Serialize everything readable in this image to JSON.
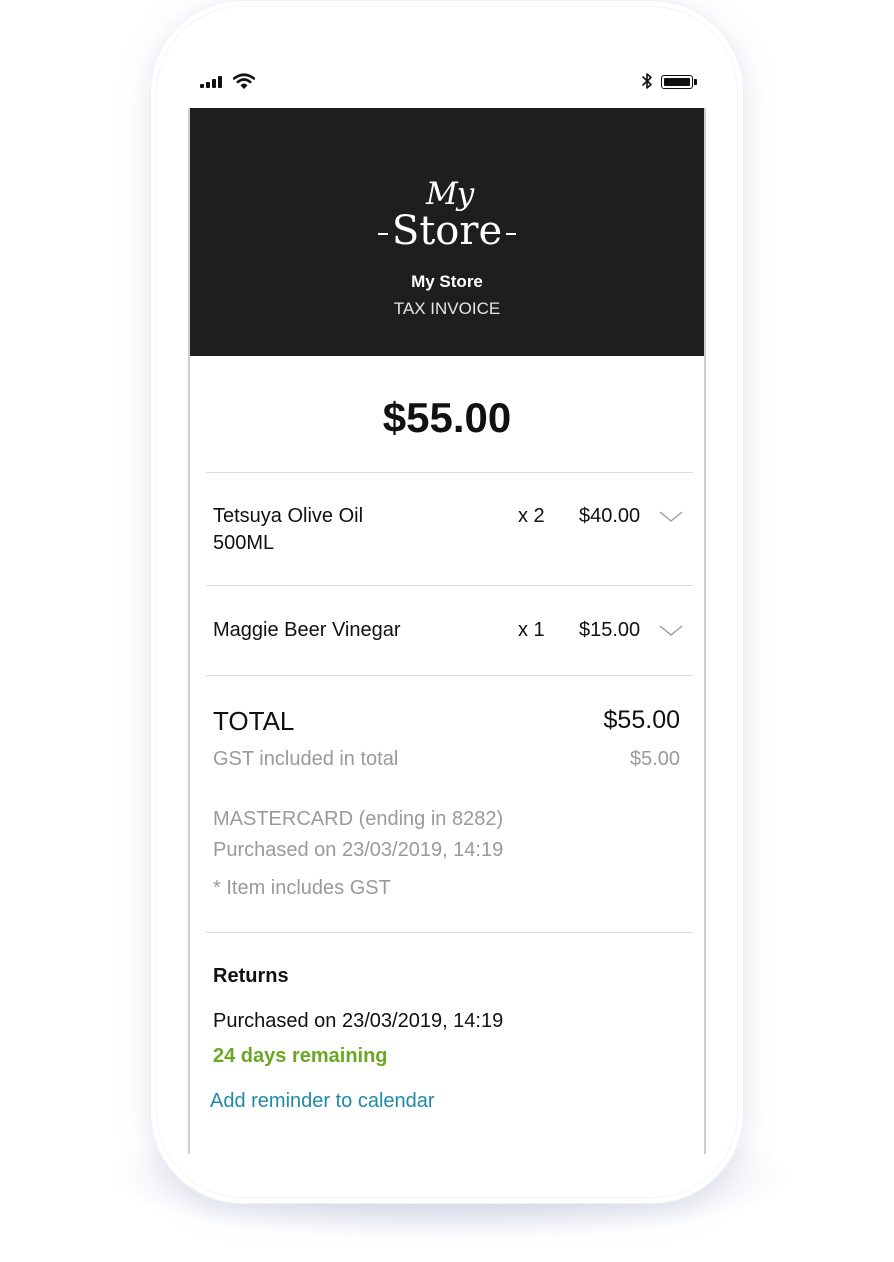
{
  "status_bar": {
    "signal_icon": "cellular-signal-icon",
    "wifi_icon": "wifi-icon",
    "bluetooth_icon": "bluetooth-icon",
    "battery_icon": "battery-full-icon"
  },
  "header": {
    "logo_my": "My",
    "logo_store": "Store",
    "store_name": "My Store",
    "document_type": "TAX INVOICE",
    "background_color": "#1e1e1e"
  },
  "receipt": {
    "amount": "$55.00",
    "items": [
      {
        "name": "Tetsuya Olive Oil 500ML",
        "quantity": "x 2",
        "price": "$40.00",
        "expand_icon": "chevron-down-icon"
      },
      {
        "name": "Maggie Beer Vinegar",
        "quantity": "x 1",
        "price": "$15.00",
        "expand_icon": "chevron-down-icon"
      }
    ],
    "total_label": "TOTAL",
    "total_value": "$55.00",
    "gst_label": "GST included in total",
    "gst_value": "$5.00",
    "payment_method": "MASTERCARD (ending in 8282)",
    "purchased_on": "Purchased on 23/03/2019, 14:19",
    "gst_note": "* Item includes GST"
  },
  "returns": {
    "title": "Returns",
    "purchased_on": "Purchased on 23/03/2019, 14:19",
    "days_remaining": "24 days remaining",
    "days_remaining_color": "#6aa823",
    "reminder_link": "Add reminder to calendar",
    "link_color": "#1d8ba6"
  }
}
